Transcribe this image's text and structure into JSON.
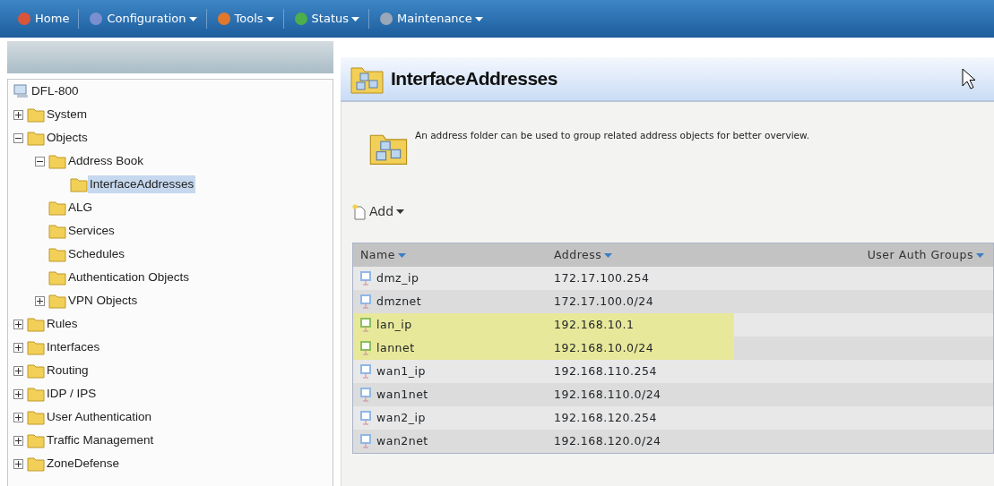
{
  "menu": [
    {
      "label": "Home",
      "dropdown": false
    },
    {
      "label": "Configuration",
      "dropdown": true
    },
    {
      "label": "Tools",
      "dropdown": true
    },
    {
      "label": "Status",
      "dropdown": true
    },
    {
      "label": "Maintenance",
      "dropdown": true
    }
  ],
  "tree": {
    "root": "DFL-800",
    "items": [
      {
        "label": "System",
        "kind": "branch",
        "expanded": false,
        "selected": false
      },
      {
        "label": "Objects",
        "kind": "branch",
        "expanded": true,
        "selected": false,
        "children": [
          {
            "label": "Address Book",
            "kind": "branch",
            "expanded": true,
            "selected": false,
            "children": [
              {
                "label": "InterfaceAddresses",
                "kind": "leaf",
                "selected": true
              }
            ]
          },
          {
            "label": "ALG",
            "kind": "leaf",
            "selected": false
          },
          {
            "label": "Services",
            "kind": "leaf",
            "selected": false
          },
          {
            "label": "Schedules",
            "kind": "leaf",
            "selected": false
          },
          {
            "label": "Authentication Objects",
            "kind": "leaf",
            "selected": false
          },
          {
            "label": "VPN Objects",
            "kind": "branch",
            "expanded": false,
            "selected": false
          }
        ]
      },
      {
        "label": "Rules",
        "kind": "branch",
        "expanded": false,
        "selected": false
      },
      {
        "label": "Interfaces",
        "kind": "branch",
        "expanded": false,
        "selected": false
      },
      {
        "label": "Routing",
        "kind": "branch",
        "expanded": false,
        "selected": false
      },
      {
        "label": "IDP / IPS",
        "kind": "branch",
        "expanded": false,
        "selected": false
      },
      {
        "label": "User Authentication",
        "kind": "branch",
        "expanded": false,
        "selected": false
      },
      {
        "label": "Traffic Management",
        "kind": "branch",
        "expanded": false,
        "selected": false
      },
      {
        "label": "ZoneDefense",
        "kind": "branch",
        "expanded": false,
        "selected": false
      }
    ]
  },
  "page": {
    "title": "InterfaceAddresses",
    "description": "An address folder can be used to group related address objects for better overview.",
    "add_button": "Add"
  },
  "table": {
    "columns": [
      "Name",
      "Address",
      "User Auth Groups"
    ],
    "rows": [
      {
        "name": "dmz_ip",
        "address": "172.17.100.254",
        "highlighted": false
      },
      {
        "name": "dmznet",
        "address": "172.17.100.0/24",
        "highlighted": false
      },
      {
        "name": "lan_ip",
        "address": "192.168.10.1",
        "highlighted": true
      },
      {
        "name": "lannet",
        "address": "192.168.10.0/24",
        "highlighted": true
      },
      {
        "name": "wan1_ip",
        "address": "192.168.110.254",
        "highlighted": false
      },
      {
        "name": "wan1net",
        "address": "192.168.110.0/24",
        "highlighted": false
      },
      {
        "name": "wan2_ip",
        "address": "192.168.120.254",
        "highlighted": false
      },
      {
        "name": "wan2net",
        "address": "192.168.120.0/24",
        "highlighted": false
      }
    ]
  }
}
